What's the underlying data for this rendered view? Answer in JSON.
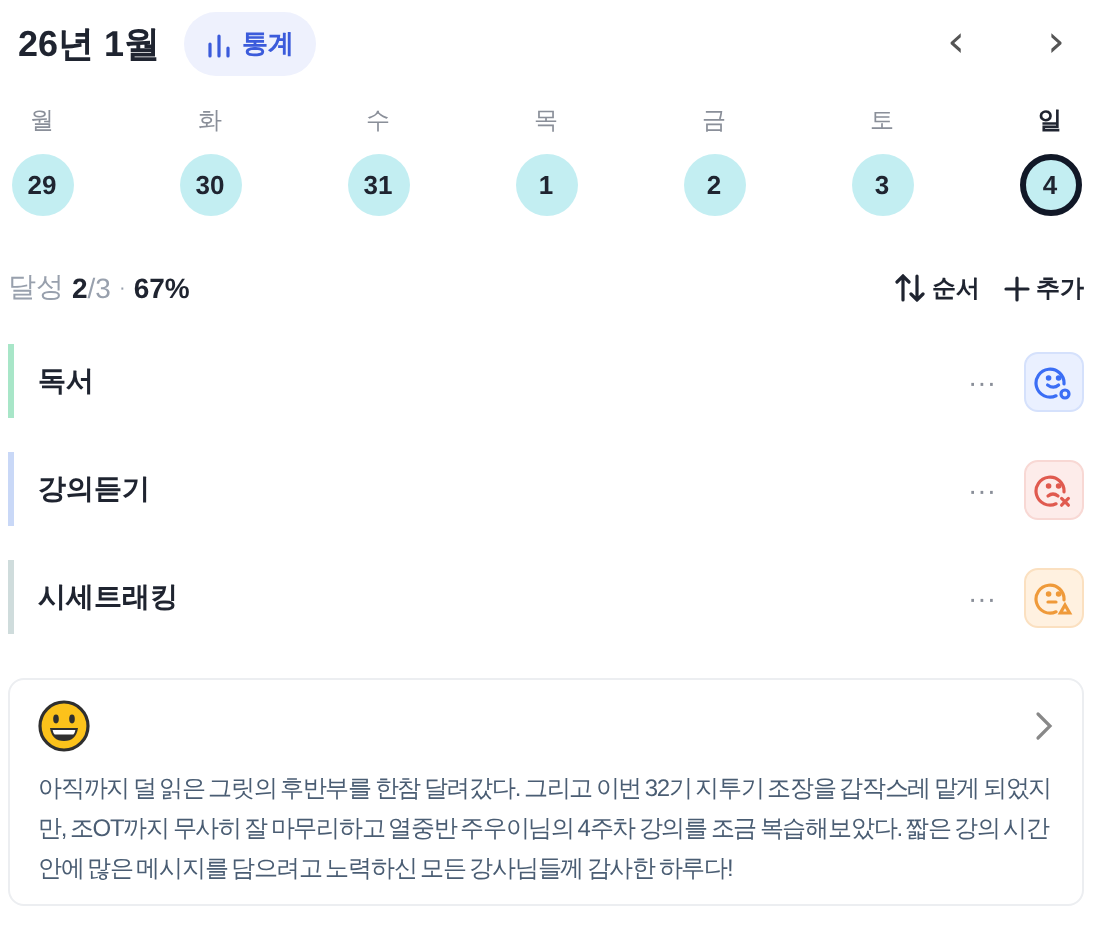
{
  "header": {
    "title": "26년 1월",
    "stats_button": "통계",
    "prev": "‹",
    "next": "›"
  },
  "week": [
    {
      "weekday": "월",
      "date": "29",
      "selected": false
    },
    {
      "weekday": "화",
      "date": "30",
      "selected": false
    },
    {
      "weekday": "수",
      "date": "31",
      "selected": false
    },
    {
      "weekday": "목",
      "date": "1",
      "selected": false
    },
    {
      "weekday": "금",
      "date": "2",
      "selected": false
    },
    {
      "weekday": "토",
      "date": "3",
      "selected": false
    },
    {
      "weekday": "일",
      "date": "4",
      "selected": true
    }
  ],
  "summary": {
    "label": "달성",
    "done": "2",
    "total": "/3",
    "separator": "·",
    "percent": "67%",
    "sort_button": "순서",
    "add_button": "추가"
  },
  "habits": [
    {
      "name": "독서",
      "color": "#a8e6c8",
      "more": "···",
      "kind": "done"
    },
    {
      "name": "강의듣기",
      "color": "#c9d8f7",
      "more": "···",
      "kind": "fail"
    },
    {
      "name": "시세트래킹",
      "color": "#cfdcdc",
      "more": "···",
      "kind": "partial"
    }
  ],
  "journal": {
    "mood": {
      "kind": "grinning"
    },
    "text": "아직까지 덜 읽은 그릿의 후반부를 한참 달려갔다. 그리고 이번 32기 지투기 조장을 갑작스레 맡게 되었지만, 조OT까지 무사히 잘 마무리하고 열중반 주우이님의 4주차 강의를 조금 복습해보았다. 짧은 강의 시간 안에 많은 메시지를 담으려고 노력하신 모든 강사님들께 감사한 하루다!"
  }
}
